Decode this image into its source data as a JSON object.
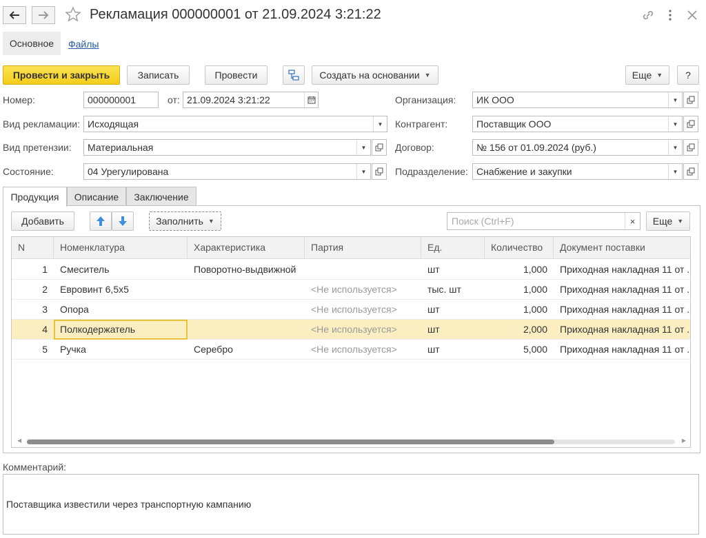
{
  "window": {
    "title": "Рекламация 000000001 от 21.09.2024 3:21:22"
  },
  "sections": {
    "main": "Основное",
    "files": "Файлы"
  },
  "toolbar": {
    "post_and_close": "Провести и закрыть",
    "save": "Записать",
    "post": "Провести",
    "create_based_on": "Создать на основании",
    "more": "Еще",
    "help": "?"
  },
  "form": {
    "number_label": "Номер:",
    "number_value": "000000001",
    "date_label": "от:",
    "date_value": "21.09.2024  3:21:22",
    "claim_type_label": "Вид рекламации:",
    "claim_type_value": "Исходящая",
    "pretension_type_label": "Вид претензии:",
    "pretension_type_value": "Материальная",
    "state_label": "Состояние:",
    "state_value": "04 Урегулирована",
    "organization_label": "Организация:",
    "organization_value": "ИК ООО",
    "counterparty_label": "Контрагент:",
    "counterparty_value": "Поставщик ООО",
    "contract_label": "Договор:",
    "contract_value": "№ 156 от 01.09.2024 (руб.)",
    "department_label": "Подразделение:",
    "department_value": "Снабжение и закупки"
  },
  "tabs": [
    "Продукция",
    "Описание",
    "Заключение"
  ],
  "table_toolbar": {
    "add": "Добавить",
    "fill": "Заполнить",
    "search_placeholder": "Поиск (Ctrl+F)",
    "clear": "×",
    "more": "Еще"
  },
  "table": {
    "columns": [
      "N",
      "Номенклатура",
      "Характеристика",
      "Партия",
      "Ед.",
      "Количество",
      "Документ поставки"
    ],
    "rows": [
      {
        "n": "1",
        "item": "Смеситель",
        "characteristic": "Поворотно-выдвижной",
        "batch": "",
        "unit": "шт",
        "qty": "1,000",
        "doc": "Приходная накладная 11 от ..."
      },
      {
        "n": "2",
        "item": "Евровинт 6,5x5",
        "characteristic": "",
        "batch": "<Не используется>",
        "unit": "тыс. шт",
        "qty": "1,000",
        "doc": "Приходная накладная 11 от ..."
      },
      {
        "n": "3",
        "item": "Опора",
        "characteristic": "",
        "batch": "<Не используется>",
        "unit": "шт",
        "qty": "1,000",
        "doc": "Приходная накладная 11 от ..."
      },
      {
        "n": "4",
        "item": "Полкодержатель",
        "characteristic": "",
        "batch": "<Не используется>",
        "unit": "шт",
        "qty": "2,000",
        "doc": "Приходная накладная 11 от ..."
      },
      {
        "n": "5",
        "item": "Ручка",
        "characteristic": "Серебро",
        "batch": "<Не используется>",
        "unit": "шт",
        "qty": "5,000",
        "doc": "Приходная накладная 11 от ..."
      }
    ],
    "selected_row": 4
  },
  "comment": {
    "label": "Комментарий:",
    "value": "Поставщика известили через транспортную кампанию"
  },
  "icons": {
    "back": "arrow-left-icon",
    "forward": "arrow-right-icon",
    "favorite": "star-icon",
    "link": "link-icon",
    "menu": "kebab-menu-icon",
    "close": "close-icon",
    "structure": "structure-icon",
    "calendar": "calendar-icon",
    "open": "open-form-icon",
    "move_up": "arrow-up-icon",
    "move_down": "arrow-down-icon"
  },
  "colors": {
    "primary_button": "#f3cd1b",
    "selected_row": "#fbeec1",
    "link": "#2158a8",
    "move_arrows": "#3f8fe0"
  }
}
